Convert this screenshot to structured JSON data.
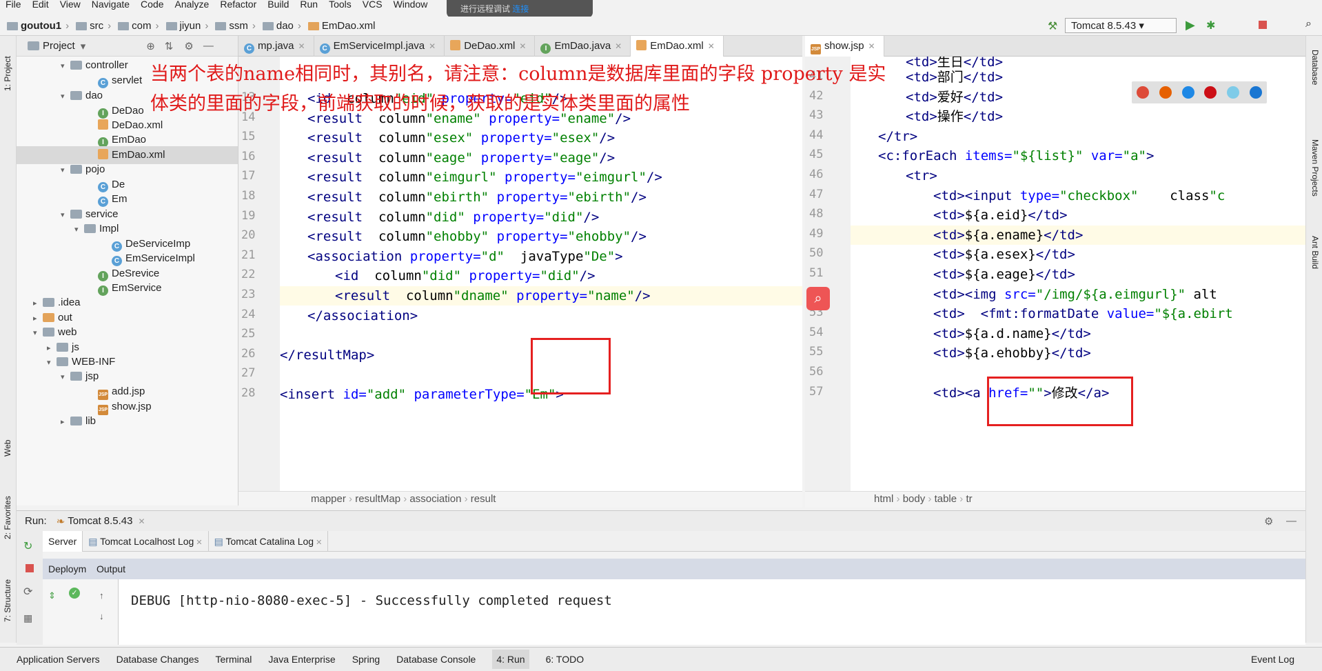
{
  "menu": [
    "File",
    "Edit",
    "View",
    "Navigate",
    "Code",
    "Analyze",
    "Refactor",
    "Build",
    "Run",
    "Tools",
    "VCS",
    "Window"
  ],
  "notice": {
    "text": "进行远程调试",
    "link": "连接"
  },
  "breadcrumb": [
    "goutou1",
    "src",
    "com",
    "jiyun",
    "ssm",
    "dao",
    "EmDao.xml"
  ],
  "run_config": "Tomcat 8.5.43",
  "project": {
    "title": "Project",
    "items": [
      {
        "label": "controller"
      },
      {
        "label": "servlet"
      },
      {
        "label": "dao"
      },
      {
        "label": "DeDao"
      },
      {
        "label": "DeDao.xml"
      },
      {
        "label": "EmDao"
      },
      {
        "label": "EmDao.xml"
      },
      {
        "label": "pojo"
      },
      {
        "label": "De"
      },
      {
        "label": "Em"
      },
      {
        "label": "service"
      },
      {
        "label": "Impl"
      },
      {
        "label": "DeServiceImp"
      },
      {
        "label": "EmServiceImpl"
      },
      {
        "label": "DeSrevice"
      },
      {
        "label": "EmService"
      },
      {
        "label": ".idea"
      },
      {
        "label": "out"
      },
      {
        "label": "web"
      },
      {
        "label": "js"
      },
      {
        "label": "WEB-INF"
      },
      {
        "label": "jsp"
      },
      {
        "label": "add.jsp"
      },
      {
        "label": "show.jsp"
      },
      {
        "label": "lib"
      }
    ]
  },
  "editor_tabs": [
    "mp.java",
    "EmServiceImpl.java",
    "DeDao.xml",
    "EmDao.java",
    "EmDao.xml"
  ],
  "right_tab": "show.jsp",
  "left_lines": {
    "numbers": [
      "13",
      "14",
      "15",
      "16",
      "17",
      "18",
      "19",
      "20",
      "21",
      "22",
      "23",
      "24",
      "25",
      "26",
      "27",
      "28"
    ],
    "code": [
      "<id  column=\"eid\" property=\"eid\"/>",
      "<result  column=\"ename\" property=\"ename\"/>",
      "<result  column=\"esex\" property=\"esex\"/>",
      "<result  column=\"eage\" property=\"eage\"/>",
      "<result  column=\"eimgurl\" property=\"eimgurl\"/>",
      "<result  column=\"ebirth\" property=\"ebirth\"/>",
      "<result  column=\"did\" property=\"did\"/>",
      "<result  column=\"ehobby\" property=\"ehobby\"/>",
      "<association property=\"d\"  javaType=\"De\">",
      "<id  column=\"did\" property=\"did\"/>",
      "<result  column=\"dname\" property=\"name\"/>",
      "</association>",
      "",
      "</resultMap>",
      "",
      "<insert id=\"add\" parameterType=\"Em\">"
    ]
  },
  "right_lines": {
    "numbers": [
      "41",
      "42",
      "43",
      "44",
      "45",
      "46",
      "47",
      "48",
      "49",
      "50",
      "51",
      "52",
      "53",
      "54",
      "55",
      "56",
      "57"
    ],
    "code": [
      "<td>部门</td>",
      "<td>爱好</td>",
      "<td>操作</td>",
      "</tr>",
      "<c:forEach items=\"${list}\" var=\"a\">",
      "<tr>",
      "<td><input type=\"checkbox\"    class=\"c",
      "<td>${a.eid}</td>",
      "<td>${a.ename}</td>",
      "<td>${a.esex}</td>",
      "<td>${a.eage}</td>",
      "<td><img src=\"/img/${a.eimgurl}\" alt",
      "<td>  <fmt:formatDate value=\"${a.ebirt",
      "<td>${a.d.name}</td>",
      "<td>${a.ehobby}</td>",
      "",
      "<td><a href=\"\">修改</a>"
    ],
    "top": "<td>生日</td>"
  },
  "annotation": "当两个表的name相同时，其别名，请注意：column是数据库里面的字段 property 是实体类的里面的字段，前端获取的时候，获取的是实体类里面的属性",
  "left_crumbs": [
    "mapper",
    "resultMap",
    "association",
    "result"
  ],
  "right_crumbs": [
    "html",
    "body",
    "table",
    "tr"
  ],
  "run": {
    "label": "Run:",
    "config": "Tomcat 8.5.43",
    "tabs": [
      "Server",
      "Tomcat Localhost Log",
      "Tomcat Catalina Log"
    ],
    "deploy": "Deploym",
    "output_label": "Output",
    "output": "DEBUG [http-nio-8080-exec-5] - Successfully completed request"
  },
  "status_tools": [
    "Application Servers",
    "Database Changes",
    "Terminal",
    "Java Enterprise",
    "Spring",
    "Database Console",
    "4: Run",
    "6: TODO"
  ],
  "event_log": "Event Log",
  "strip_labels": {
    "project": "1: Project",
    "web": "Web",
    "favorites": "2: Favorites",
    "structure": "7: Structure",
    "database": "Database",
    "maven": "Maven Projects",
    "ant": "Ant Build"
  }
}
